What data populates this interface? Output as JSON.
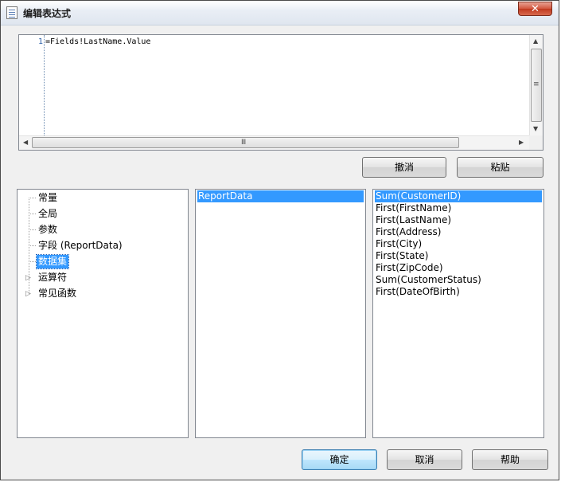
{
  "window": {
    "title": "编辑表达式",
    "close_glyph": "✕"
  },
  "editor": {
    "line_number": "1",
    "code": "=Fields!LastName.Value",
    "vscroll_grip": "≡",
    "hscroll_grip": "Ⅲ"
  },
  "edit_buttons": {
    "undo": "撤消",
    "paste": "粘贴"
  },
  "category_tree": {
    "items": [
      {
        "label": "常量",
        "expandable": false
      },
      {
        "label": "全局",
        "expandable": false
      },
      {
        "label": "参数",
        "expandable": false
      },
      {
        "label": "字段 (ReportData)",
        "expandable": false
      },
      {
        "label": "数据集",
        "expandable": false,
        "selected": true
      },
      {
        "label": "运算符",
        "expandable": true
      },
      {
        "label": "常见函数",
        "expandable": true
      }
    ]
  },
  "item_list": {
    "items": [
      "ReportData"
    ],
    "selected_index": 0
  },
  "value_list": {
    "items": [
      "Sum(CustomerID)",
      "First(FirstName)",
      "First(LastName)",
      "First(Address)",
      "First(City)",
      "First(State)",
      "First(ZipCode)",
      "Sum(CustomerStatus)",
      "First(DateOfBirth)"
    ],
    "selected_index": 0
  },
  "dialog_buttons": {
    "ok": "确定",
    "cancel": "取消",
    "help": "帮助"
  }
}
